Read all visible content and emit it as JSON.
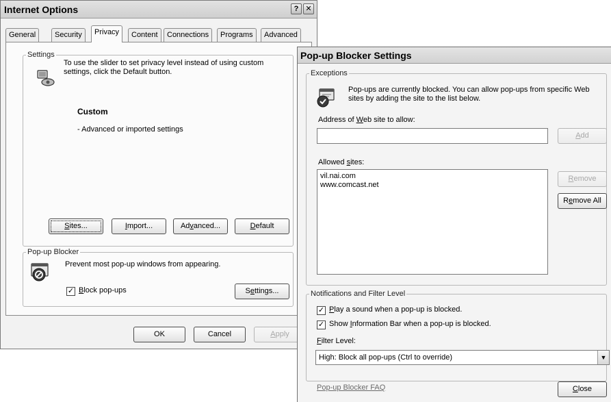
{
  "internet_options": {
    "title": "Internet Options",
    "help_button": "?",
    "close_button": "✕",
    "tabs": [
      {
        "label": "General",
        "active": false
      },
      {
        "label": "Security",
        "active": false
      },
      {
        "label": "Privacy",
        "active": true
      },
      {
        "label": "Content",
        "active": false
      },
      {
        "label": "Connections",
        "active": false
      },
      {
        "label": "Programs",
        "active": false
      },
      {
        "label": "Advanced",
        "active": false
      }
    ],
    "settings": {
      "legend": "Settings",
      "description": "To use the slider to set privacy level instead of using custom settings, click the Default button.",
      "level_name": "Custom",
      "level_desc": "- Advanced or imported settings",
      "buttons": {
        "sites": {
          "pre": "",
          "key": "S",
          "post": "ites..."
        },
        "import": {
          "pre": "",
          "key": "I",
          "post": "mport..."
        },
        "advanced": {
          "pre": "Ad",
          "key": "v",
          "post": "anced..."
        },
        "default": {
          "pre": "",
          "key": "D",
          "post": "efault"
        }
      }
    },
    "popup_blocker": {
      "legend": "Pop-up Blocker",
      "description": "Prevent most pop-up windows from appearing.",
      "block_checked": true,
      "block_label": {
        "pre": "",
        "key": "B",
        "post": "lock pop-ups"
      },
      "settings_button": {
        "pre": "S",
        "key": "e",
        "post": "ttings..."
      }
    },
    "footer": {
      "ok": "OK",
      "cancel": "Cancel",
      "apply": {
        "pre": "",
        "key": "A",
        "post": "pply"
      }
    }
  },
  "popup_settings": {
    "title": "Pop-up Blocker Settings",
    "exceptions": {
      "legend": "Exceptions",
      "description": "Pop-ups are currently blocked.  You can allow pop-ups from specific Web sites by adding the site to the list below.",
      "address_label": {
        "pre": "Address of ",
        "key": "W",
        "post": "eb site to allow:"
      },
      "address_value": "",
      "add_button": {
        "pre": "",
        "key": "A",
        "post": "dd"
      },
      "allowed_label": {
        "pre": "Allowed ",
        "key": "s",
        "post": "ites:"
      },
      "allowed_sites": [
        "vil.nai.com",
        "www.comcast.net"
      ],
      "remove_button": {
        "pre": "",
        "key": "R",
        "post": "emove"
      },
      "remove_all_button": {
        "pre": "R",
        "key": "e",
        "post": "move All"
      }
    },
    "notifications": {
      "legend": "Notifications and Filter Level",
      "play_sound": {
        "checked": true,
        "pre": "",
        "key": "P",
        "post": "lay a sound when a pop-up is blocked."
      },
      "show_info_bar": {
        "checked": true,
        "pre": "Show ",
        "key": "I",
        "post": "nformation Bar when a pop-up is blocked."
      },
      "filter_label": {
        "pre": "",
        "key": "F",
        "post": "ilter Level:"
      },
      "filter_value": "High: Block all pop-ups (Ctrl to override)"
    },
    "faq_link": "Pop-up Blocker FAQ",
    "close_button": {
      "pre": "",
      "key": "C",
      "post": "lose"
    }
  }
}
